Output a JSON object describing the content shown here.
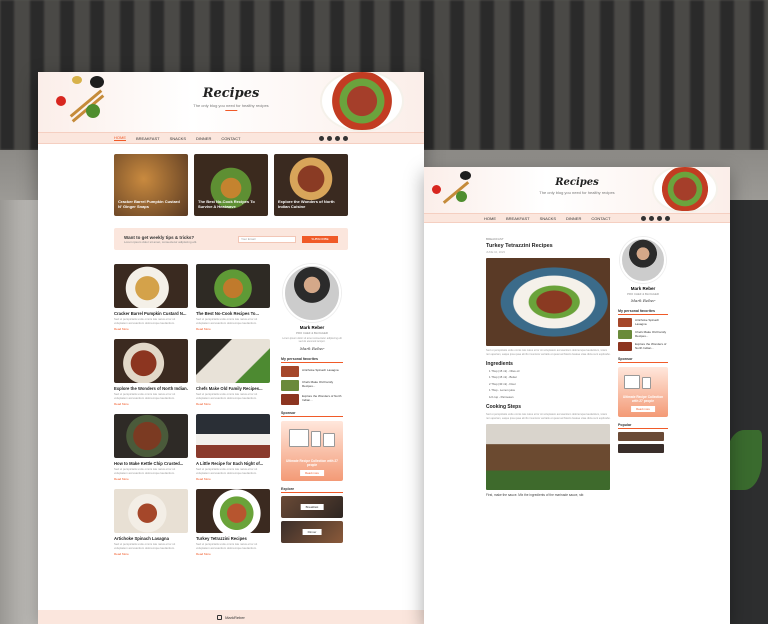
{
  "site": {
    "title": "Recipes",
    "tagline": "The only blog you need for healthy recipes"
  },
  "nav": {
    "items": [
      "HOME",
      "BREAKFAST",
      "SNACKS",
      "DINNER",
      "CONTACT"
    ],
    "active": "HOME"
  },
  "featured": [
    {
      "title": "Cracker Barrel Pumpkin Custard N' Ginger Snaps",
      "date": "JUNE 10, 2023"
    },
    {
      "title": "The Best No-Cook Recipes To Survive A Heatwave",
      "date": "JUNE 10, 2023"
    },
    {
      "title": "Explore the Wonders of North Indian Cuisine",
      "date": "JUNE 10, 2023"
    }
  ],
  "subscribe": {
    "heading": "Want to get weekly tips & tricks?",
    "sub": "Lorem ipsum dolor sit amet, consectetur adipiscing elit.",
    "placeholder": "Your Email",
    "button": "SUBSCRIBE"
  },
  "recipes": [
    {
      "title": "Cracker Barrel Pumpkin Custard N...",
      "desc": "Sed ut perspiciatis unde omnis iste natus error sit voluptatem accusantium doloremque laudantium.",
      "more": "Read More"
    },
    {
      "title": "The Best No-Cook Recipes To...",
      "desc": "Sed ut perspiciatis unde omnis iste natus error sit voluptatem accusantium doloremque laudantium.",
      "more": "Read More"
    },
    {
      "title": "Explore the Wonders of North Indian...",
      "desc": "Sed ut perspiciatis unde omnis iste natus error sit voluptatem accusantium doloremque laudantium.",
      "more": "Read More"
    },
    {
      "title": "Chefs Make Old Family Recipes...",
      "desc": "Sed ut perspiciatis unde omnis iste natus error sit voluptatem accusantium doloremque laudantium.",
      "more": "Read More"
    },
    {
      "title": "How to Make Kettle Chip Crusted...",
      "desc": "Sed ut perspiciatis unde omnis iste natus error sit voluptatem accusantium doloremque laudantium.",
      "more": "Read More"
    },
    {
      "title": "A Little Recipe for Each Night of...",
      "desc": "Sed ut perspiciatis unde omnis iste natus error sit voluptatem accusantium doloremque laudantium.",
      "more": "Read More"
    },
    {
      "title": "Artichoke Spinach Lasagna",
      "desc": "Sed ut perspiciatis unde omnis iste natus error sit voluptatem accusantium doloremque laudantium.",
      "more": "Read More"
    },
    {
      "title": "Turkey Tetrazzini Recipes",
      "desc": "Sed ut perspiciatis unde omnis iste natus error sit voluptatem accusantium doloremque laudantium.",
      "more": "Read More"
    }
  ],
  "author": {
    "name": "Mark Reber",
    "role": "PRO CHEF & BLOGGER",
    "bio": "Lorem ipsum dolor sit amet consectetur adipiscing elit sed do eiusmod tempor.",
    "signature": "Mark Reber"
  },
  "sidebar": {
    "favorites_heading": "My personal favorites",
    "favorites": [
      "Artichoke Spinach Lasagna",
      "Chefs Make Old Family Recipes...",
      "Explore the Wonders of North Indian..."
    ],
    "sponsor_heading": "Sponsor",
    "sponsor_text": "Ultimate Recipe Collection with 27 people",
    "sponsor_button": "Read more",
    "explore_heading": "Explore",
    "explore_buttons": [
      "Breakfast",
      "Dinner"
    ]
  },
  "footer": {
    "handle": "MarkReber"
  },
  "post": {
    "crumb": "BREAKFAST",
    "title": "Turkey Tetrazzini Recipes",
    "date": "JUNE 10, 2023",
    "intro": "Sed ut perspiciatis unde omnis iste natus error sit voluptatem accusantium doloremque laudantium, totam rem aperiam, eaque ipsa quae ab illo inventore veritatis et quasi architecto beatae vitae dicta sunt explicabo.",
    "ingredients_heading": "Ingredients",
    "ingredients": [
      "1 Tbsp (15 ml) - Olive oil",
      "1 Tbsp (15 ml) - Butter",
      "2 Tbsp (30 ml) - Flour",
      "1 Tbsp - Lemon juice",
      "1/2 cup - Parmesan"
    ],
    "steps_heading": "Cooking Steps",
    "step_caption": "First, make the sauce. Mix the ingredients of the marinade sauce, stir."
  },
  "popular_heading": "Popular"
}
